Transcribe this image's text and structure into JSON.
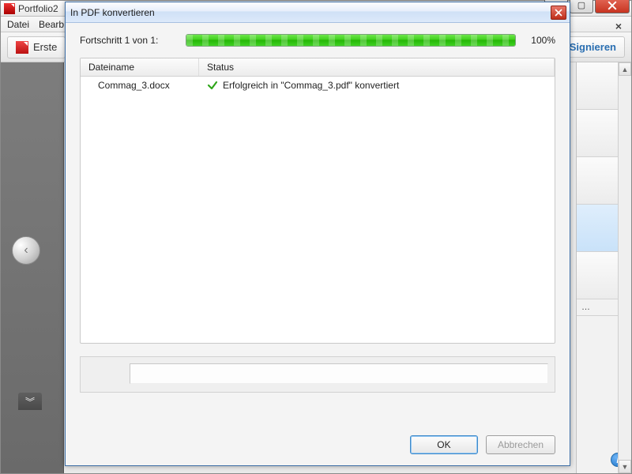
{
  "window": {
    "title": "Portfolio2",
    "controls": {
      "minimize": "–",
      "maximize": "▢",
      "close": "✕"
    }
  },
  "menubar": {
    "file": "Datei",
    "edit": "Bearb"
  },
  "toolbar": {
    "create_label": "Erste",
    "sign_label": "Signieren"
  },
  "right_panel": {
    "options_label": "…",
    "info_glyph": "i"
  },
  "nav": {
    "prev_glyph": "‹",
    "expand_glyph": "︾"
  },
  "dialog": {
    "title": "In PDF konvertieren",
    "progress_label": "Fortschritt 1 von 1:",
    "progress_percent_text": "100%",
    "progress_percent_value": 100,
    "columns": {
      "filename": "Dateiname",
      "status": "Status"
    },
    "rows": [
      {
        "filename": "Commag_3.docx",
        "status": "Erfolgreich in \"Commag_3.pdf\" konvertiert"
      }
    ],
    "buttons": {
      "ok": "OK",
      "cancel": "Abbrechen"
    }
  }
}
